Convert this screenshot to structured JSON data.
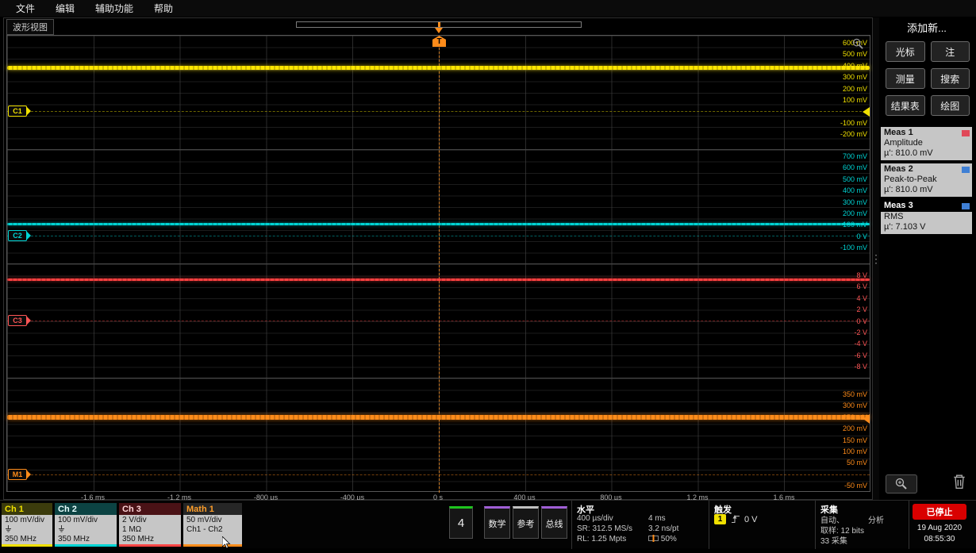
{
  "menu": {
    "items": [
      "文件",
      "编辑",
      "辅助功能",
      "帮助"
    ]
  },
  "wv": {
    "tab": "波形视图",
    "trigger_flag": "T",
    "time": [
      "-1.6 ms",
      "-1.2 ms",
      "-800 µs",
      "-400 µs",
      "0 s",
      "400 µs",
      "800 µs",
      "1.2 ms",
      "1.6 ms"
    ],
    "scales": {
      "ch1": [
        "600 mV",
        "500 mV",
        "400 mV",
        "300 mV",
        "200 mV",
        "100 mV",
        "",
        "-100 mV",
        "-200 mV"
      ],
      "ch2": [
        "700 mV",
        "600 mV",
        "500 mV",
        "400 mV",
        "300 mV",
        "200 mV",
        "100 mV",
        "0 V",
        "-100 mV"
      ],
      "ch3": [
        "8 V",
        "6 V",
        "4 V",
        "2 V",
        "0 V",
        "-2 V",
        "-4 V",
        "-6 V",
        "-8 V"
      ],
      "m1": [
        "350 mV",
        "300 mV",
        "250 mV",
        "200 mV",
        "150 mV",
        "100 mV",
        "50 mV",
        "",
        "-50 mV"
      ]
    },
    "tags": {
      "ch1": "C1",
      "ch2": "C2",
      "ch3": "C3",
      "m1": "M1"
    },
    "colors": {
      "ch1": "#f0e000",
      "ch2": "#00d4d4",
      "ch3": "#ff4040",
      "math1": "#ff8c1a",
      "ch4": "#1ec41e",
      "trigger": "#ff8c1a"
    }
  },
  "panel": {
    "title": "添加新...",
    "buttons": [
      "光标",
      "注",
      "测量",
      "搜索",
      "结果表",
      "绘图"
    ]
  },
  "meas": [
    {
      "name": "Meas 1",
      "type": "Amplitude",
      "value": "µ': 810.0 mV",
      "tag_color": "#e04858"
    },
    {
      "name": "Meas 2",
      "type": "Peak-to-Peak",
      "value": "µ': 810.0 mV",
      "tag_color": "#3f7fd4"
    },
    {
      "name": "Meas 3",
      "type": "RMS",
      "value": "µ': 7.103 V",
      "tag_color": "#3f7fd4"
    }
  ],
  "badges": [
    {
      "name": "Ch 1",
      "line1": "100 mV/div",
      "line3": "350 MHz",
      "color": "#f0e000"
    },
    {
      "name": "Ch 2",
      "line1": "100 mV/div",
      "line3": "350 MHz",
      "color": "#00d4d4"
    },
    {
      "name": "Ch 3",
      "line1": "2 V/div",
      "line2": "1 MΩ",
      "line3": "350 MHz",
      "color": "#ff4444"
    },
    {
      "name": "Math 1",
      "line1": "50 mV/div",
      "line2": "Ch1 - Ch2",
      "color": "#ff8c1a"
    }
  ],
  "src": {
    "ch4": "4",
    "math": "数学",
    "ref": "参考",
    "bus": "总线"
  },
  "horizontal": {
    "label": "水平",
    "scale": "400 µs/div",
    "span": "4 ms",
    "sr": "SR: 312.5 MS/s",
    "res": "3.2 ns/pt",
    "rl": "RL: 1.25 Mpts",
    "pos": "50%"
  },
  "trigger": {
    "label": "触发",
    "source": "1",
    "level": "0 V"
  },
  "acq": {
    "label": "采集",
    "mode": "自动、",
    "analyze": "分析",
    "sample": "取样: 12 bits",
    "count": "33 采集"
  },
  "run": {
    "state": "已停止"
  },
  "clock": {
    "date": "19 Aug 2020",
    "time": "08:55:30"
  }
}
